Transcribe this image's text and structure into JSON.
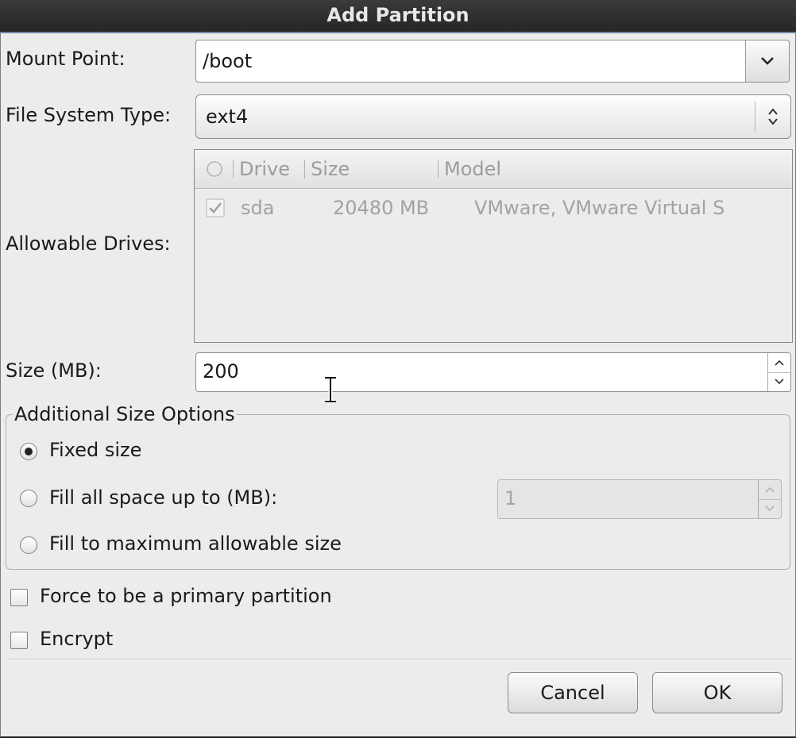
{
  "dialog": {
    "title": "Add Partition"
  },
  "mount_point": {
    "label": "Mount Point:",
    "value": "/boot"
  },
  "fs_type": {
    "label": "File System Type:",
    "value": "ext4"
  },
  "drives": {
    "label": "Allowable Drives:",
    "columns": [
      "Drive",
      "Size",
      "Model"
    ],
    "rows": [
      {
        "checked": true,
        "drive": "sda",
        "size": "20480 MB",
        "model": "VMware, VMware Virtual S"
      }
    ]
  },
  "size": {
    "label": "Size (MB):",
    "value": "200"
  },
  "size_options": {
    "legend": "Additional Size Options",
    "fixed": "Fixed size",
    "fill_upto": "Fill all space up to (MB):",
    "fill_upto_value": "1",
    "fill_max": "Fill to maximum allowable size",
    "selected": "fixed"
  },
  "force_primary": {
    "label": "Force to be a primary partition",
    "checked": false
  },
  "encrypt": {
    "label": "Encrypt",
    "checked": false
  },
  "buttons": {
    "cancel": "Cancel",
    "ok": "OK"
  },
  "icons": {
    "combo": "chevron-down-icon",
    "select": "up-down-arrows-icon",
    "spin": "spin-arrows-icon",
    "cursor": "text-cursor-icon"
  }
}
